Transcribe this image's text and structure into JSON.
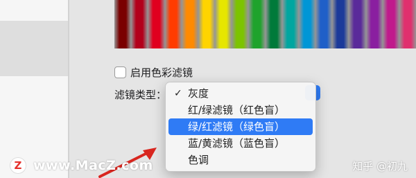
{
  "accessibility": {
    "enable_color_filter_label": "启用色彩滤镜",
    "filter_type_label": "滤镜类型：",
    "filter_menu": {
      "options": [
        {
          "label": "灰度",
          "checked": true,
          "highlighted": false
        },
        {
          "label": "红/绿滤镜（红色盲）",
          "checked": false,
          "highlighted": false
        },
        {
          "label": "绿/红滤镜（绿色盲）",
          "checked": false,
          "highlighted": true
        },
        {
          "label": "蓝/黄滤镜（蓝色盲）",
          "checked": false,
          "highlighted": false
        },
        {
          "label": "色调",
          "checked": false,
          "highlighted": false
        }
      ],
      "check_mark": "✓"
    },
    "pencil_colors": [
      "#7a0000",
      "#b3001b",
      "#e0001f",
      "#ff3c00",
      "#ff8a00",
      "#ffd400",
      "#e6e600",
      "#7cc400",
      "#1fa32c",
      "#007a3a",
      "#00a6a0",
      "#0096d6",
      "#1f5fc8",
      "#1b3a9a",
      "#5a2a9a",
      "#8a1fa0",
      "#c01a8c",
      "#e0306e"
    ],
    "accent_color": "#2f7bf5"
  },
  "watermarks": {
    "site_logo_letter": "Z",
    "site_text": "www.MacZ.com",
    "author_text": "知乎 @初九"
  }
}
